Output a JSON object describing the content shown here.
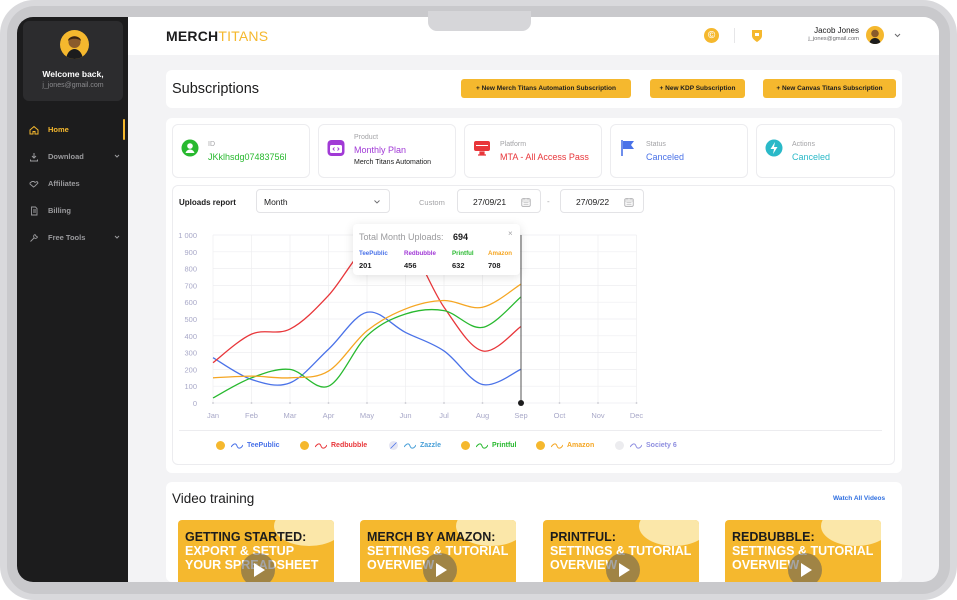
{
  "colors": {
    "accent": "#f5b82e",
    "sidebar": "#1c1c1d",
    "teepublic": "#4a72e8",
    "redbubble": "#e8363a",
    "zazzle": "#4aa0d8",
    "printful": "#28b92f",
    "amazon": "#f5a623",
    "society6": "#8f8fe0"
  },
  "sidebar": {
    "welcome": "Welcome back,",
    "email": "j_jones@gmail.com",
    "items": [
      {
        "label": "Home",
        "icon": "home-icon"
      },
      {
        "label": "Download",
        "icon": "download-icon"
      },
      {
        "label": "Affiliates",
        "icon": "handshake-icon"
      },
      {
        "label": "Billing",
        "icon": "document-icon"
      },
      {
        "label": "Free Tools",
        "icon": "wrench-icon"
      }
    ]
  },
  "header": {
    "logo_a": "MERCH",
    "logo_b": "TITANS",
    "coin_glyph": "©",
    "user_name": "Jacob Jones",
    "user_email": "j_jones@gmail.com"
  },
  "subscriptions": {
    "title": "Subscriptions",
    "btn_automation": "+ New Merch Titans Automation Subscription",
    "btn_kdp": "+ New KDP Subscription",
    "btn_canvas": "+ New Canvas Titans Subscription"
  },
  "info": {
    "id_label": "ID",
    "id_value": "JKklhsdg07483756l",
    "product_label": "Product",
    "product_value": "Monthly Plan",
    "product_sub": "Merch Titans Automation",
    "platform_label": "Platform",
    "platform_value": "MTA - All Access Pass",
    "status_label": "Status",
    "status_value": "Canceled",
    "actions_label": "Actions",
    "actions_value": "Canceled"
  },
  "report": {
    "label": "Uploads report",
    "period": "Month",
    "custom": "Custom",
    "date_from": "27/09/21",
    "date_to": "27/09/22",
    "dash": "-"
  },
  "tooltip": {
    "title": "Total Month Uploads:",
    "total": "694",
    "close": "×",
    "items": [
      {
        "name": "TeePublic",
        "value": "201"
      },
      {
        "name": "Redbubble",
        "value": "456"
      },
      {
        "name": "Printful",
        "value": "632"
      },
      {
        "name": "Amazon",
        "value": "708"
      }
    ]
  },
  "chart_data": {
    "type": "line",
    "categories": [
      "Jan",
      "Feb",
      "Mar",
      "Apr",
      "May",
      "Jun",
      "Jul",
      "Aug",
      "Sep",
      "Oct",
      "Nov",
      "Dec"
    ],
    "ylim": [
      0,
      1000
    ],
    "yticks": [
      "0",
      "100",
      "200",
      "300",
      "400",
      "500",
      "600",
      "700",
      "800",
      "900",
      "1 000"
    ],
    "grid": true,
    "legend_position": "bottom",
    "series": [
      {
        "name": "TeePublic",
        "values": [
          270,
          140,
          120,
          320,
          540,
          420,
          310,
          110,
          201
        ]
      },
      {
        "name": "Redbubble",
        "values": [
          240,
          410,
          440,
          640,
          930,
          960,
          570,
          310,
          456
        ]
      },
      {
        "name": "Printful",
        "values": [
          30,
          150,
          200,
          100,
          400,
          530,
          550,
          450,
          632
        ]
      },
      {
        "name": "Amazon",
        "values": [
          150,
          160,
          150,
          190,
          430,
          560,
          610,
          570,
          708
        ]
      },
      {
        "name": "Zazzle",
        "values": []
      },
      {
        "name": "Society 6",
        "values": []
      }
    ]
  },
  "video": {
    "title": "Video training",
    "link": "Watch All Videos",
    "items": [
      {
        "line1": "GETTING STARTED:",
        "line2": "EXPORT & SETUP",
        "line3": "YOUR SPREADSHEET"
      },
      {
        "line1": "MERCH BY AMAZON:",
        "line2": "SETTINGS & TUTORIAL",
        "line3": "OVERVIEW"
      },
      {
        "line1": "PRINTFUL:",
        "line2": "SETTINGS & TUTORIAL",
        "line3": "OVERVIEW"
      },
      {
        "line1": "REDBUBBLE:",
        "line2": "SETTINGS & TUTORIAL",
        "line3": "OVERVIEW"
      }
    ]
  }
}
